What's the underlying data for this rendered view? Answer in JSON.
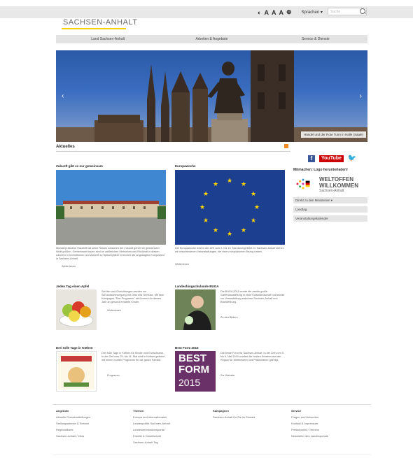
{
  "header": {
    "logo": "SACHSEN-ANHALT",
    "tools": [
      "◐",
      "A",
      "A",
      "A",
      "⊕"
    ],
    "language": "Sprachen ▾",
    "search_placeholder": "Suche"
  },
  "nav": {
    "items": [
      "Land Sachsen-Anhalt",
      "Arbeiten & Angebote",
      "Service & Dienste"
    ]
  },
  "hero": {
    "caption": "Händel und der Rote Turm in Halle (Saale)",
    "prev": "‹",
    "next": "›"
  },
  "section": {
    "title": "Aktuelles"
  },
  "sidebar": {
    "facebook": "f",
    "youtube": "YouTube",
    "twitter": "🐦",
    "heading": "Mitmachen: Logo herunterladen!",
    "welcome_line1": "WELTOFFEN",
    "welcome_line2": "WILLKOMMEN",
    "welcome_sub": "Sachsen-Anhalt",
    "links": [
      "Direkt zu den Ministerien ▾",
      "Landtag",
      "Veranstaltungskalender"
    ]
  },
  "articles": [
    {
      "title": "Zukunft gibt es nur gemeinsam",
      "text": "Ministerpräsident Haseloff hat seine Reisen zwischen der Zukunft gehört es gemeinsam: Wollt grüßen. Gemeinsam bauen sind an zahlreichen Menschen und Rückhalt in diesen Ländern in Investitionen und Zukunft zu Spitzenplätze erreichen die angesagten Europaland in Sachsen-Anhalt.",
      "more": "Weiterlesen"
    },
    {
      "title": "Europawoche",
      "text": "Die Europawoche wird in der Zeit vom 2. bis 10. Mai durchgeführt. In Sachsen-Anhalt stehen wir verschiedenen Veranstaltungen, die einen europäischen Bezug haben.",
      "more": "Weiterlesen"
    },
    {
      "title": "Jeden Tag einen Apfel",
      "text": "Schüler und Einrichtungen werden zur Schulobstversorgung mit Obst und Gemüse. Mit dem Kampagne \"Das Programm\" wird erneut für dieses Jahr an gesund ernährte Kinder.",
      "more": "Weiterlesen"
    },
    {
      "title": "Landesfungschulunde BUGA",
      "text": "Die BUGA 2015 wurde die zweite große Gartenausstellung in einer Kulturlandschaft und wurde zur Veranstaltung zwischen Sachsen-Anhalt und Brandenburg.",
      "more": "Zu den Bildern"
    },
    {
      "title": "Drei tolle Tage in Köthen",
      "text": "Drei tolle Tage in Köthen für Kinder und Erwachsene. In der Zeit vom 29. bis 31. Mai wird in Köthen gefeiert mit einem bunten Programm für die ganze Familie.",
      "more": "Programm"
    },
    {
      "title": "Best Form 2015",
      "text": "Die beste Form für Sachsen-Anhalt. In der Zeit vom 5. bis 6. Mai 2015 wurden die besten Arbeiten aus der Region für Wettbewerb und Präsentation gezeigt.",
      "more": "Zur Website"
    }
  ],
  "best_form": {
    "line1": "BEST",
    "line2": "FORM",
    "line3": "2015"
  },
  "footer": {
    "cols": [
      {
        "h": "Angebote",
        "items": [
          "Aktuelle Pressemitteilungen",
          "Stellungnahmen & Service",
          "Regionalkarte",
          "Sachsen-Anhalt / Infos"
        ]
      },
      {
        "h": "Themen",
        "items": [
          "Europa und Internationales",
          "Landespolitik Sachsen-Anhalt",
          "Landesinformationsportal",
          "Familie & Gesellschaft",
          "Sachsen-Anhalt Tag"
        ]
      },
      {
        "h": "Kampagnen",
        "items": [
          "Sachsen-Anhalt für Sie im Einsatz"
        ]
      },
      {
        "h": "Service",
        "items": [
          "Fragen und Antworten",
          "Kontakt & Impressum",
          "Presseportal / Termine",
          "Newsletter des Landesportals"
        ]
      }
    ]
  }
}
